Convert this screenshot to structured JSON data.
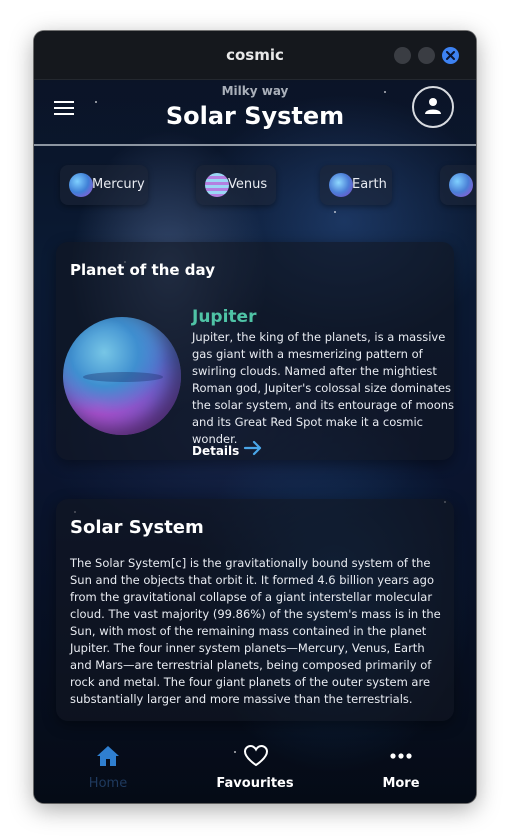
{
  "window": {
    "title": "cosmic"
  },
  "header": {
    "subtitle": "Milky way",
    "title": "Solar System"
  },
  "chips": [
    {
      "label": "Mercury",
      "icon": "mercury-icon"
    },
    {
      "label": "Venus",
      "icon": "venus-icon"
    },
    {
      "label": "Earth",
      "icon": "earth-icon"
    },
    {
      "label": "",
      "icon": "planet-icon"
    }
  ],
  "planet_of_day": {
    "heading": "Planet of the day",
    "name": "Jupiter",
    "description": "Jupiter, the king of the planets, is a massive gas giant with a mesmerizing pattern of swirling clouds. Named after the mightiest Roman god, Jupiter's colossal size dominates the solar system, and its entourage of moons and its Great Red Spot make it a cosmic wonder.",
    "details_label": "Details"
  },
  "solar_system": {
    "heading": "Solar System",
    "description": "The Solar System[c] is the gravitationally bound system of the Sun and the objects that orbit it. It formed 4.6 billion years ago from the gravitational collapse of a giant interstellar molecular cloud. The vast majority (99.86%) of the system's mass is in the Sun, with most of the remaining mass contained in the planet Jupiter. The four inner system planets—Mercury, Venus, Earth and Mars—are terrestrial planets, being composed primarily of rock and metal. The four giant planets of the outer system are substantially larger and more massive than the terrestrials."
  },
  "nav": {
    "home": "Home",
    "favourites": "Favourites",
    "more": "More"
  },
  "colors": {
    "accent_teal": "#4fc3a6",
    "accent_blue": "#4aa6e8",
    "close_button": "#3d82f2"
  }
}
